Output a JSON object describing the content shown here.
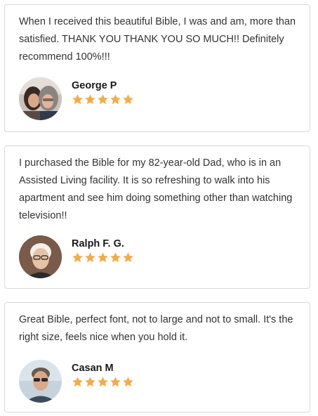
{
  "reviews": [
    {
      "text": "When I received this beautiful Bible, I was and am, more than satisfied. THANK YOU THANK YOU SO MUCH!! Definitely recommend 100%!!!",
      "author": "George P",
      "rating": 5
    },
    {
      "text": "I purchased the Bible for my 82-year-old Dad, who is in an Assisted Living facility. It is so refreshing to walk into his apartment and see him doing something other than watching television!!",
      "author": "Ralph F. G.",
      "rating": 5
    },
    {
      "text": "Great Bible, perfect font, not to large and not to small. It's the right size, feels nice when you hold it.",
      "author": "Casan M",
      "rating": 5
    }
  ],
  "colors": {
    "star": "#f0ad4e",
    "border": "#d9d9d9",
    "text": "#333333"
  },
  "icons": {
    "rating": "star-icon"
  }
}
